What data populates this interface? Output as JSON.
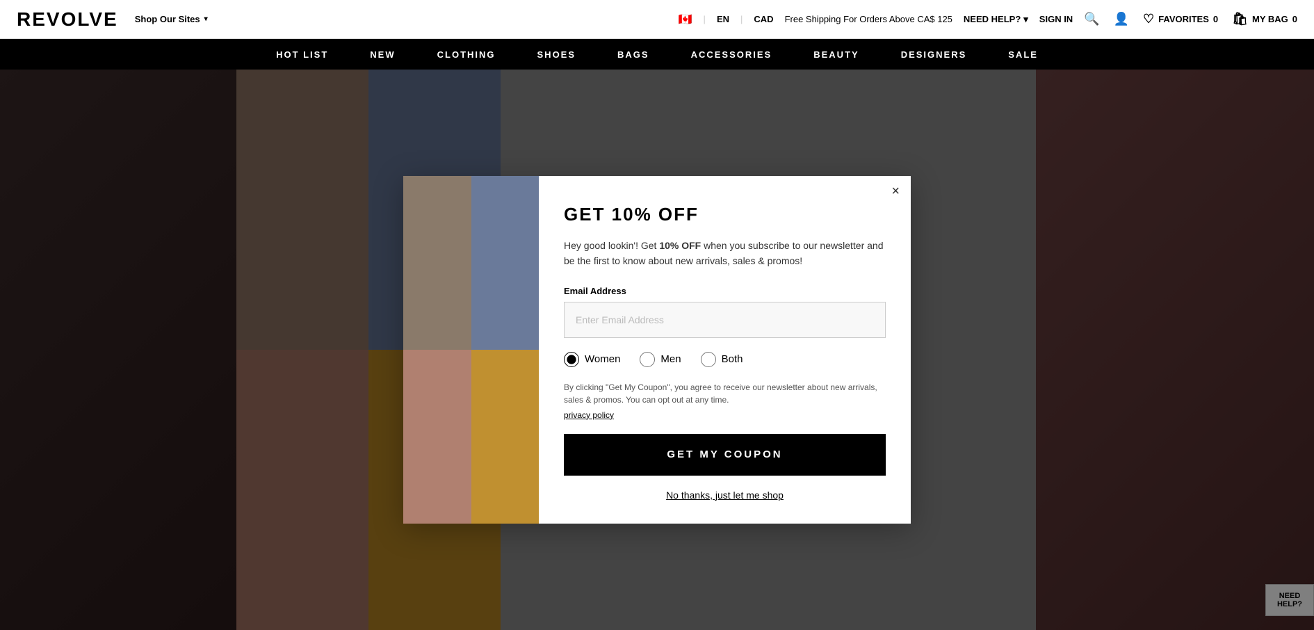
{
  "header": {
    "logo": "REVOLVE",
    "shop_sites_label": "Shop Our Sites",
    "flag_emoji": "🇨🇦",
    "language": "EN",
    "currency": "CAD",
    "shipping_text": "Free Shipping For Orders Above CA$ 125",
    "need_help_label": "NEED HELP?",
    "sign_in_label": "SIGN IN",
    "favorites_label": "FAVORITES",
    "favorites_count": "0",
    "bag_label": "MY BAG",
    "bag_count": "0"
  },
  "nav": {
    "items": [
      {
        "label": "HOT LIST"
      },
      {
        "label": "NEW"
      },
      {
        "label": "CLOTHING"
      },
      {
        "label": "SHOES"
      },
      {
        "label": "BAGS"
      },
      {
        "label": "ACCESSORIES"
      },
      {
        "label": "BEAUTY"
      },
      {
        "label": "DESIGNERS"
      },
      {
        "label": "SALE"
      }
    ]
  },
  "modal": {
    "title": "GET 10% OFF",
    "description_prefix": "Hey good lookin'! Get ",
    "description_bold": "10% OFF",
    "description_suffix": " when you subscribe to our newsletter and be the first to know about new arrivals, sales & promos!",
    "email_label": "Email Address",
    "email_placeholder": "Enter Email Address",
    "radio_options": [
      {
        "value": "women",
        "label": "Women",
        "checked": true
      },
      {
        "value": "men",
        "label": "Men",
        "checked": false
      },
      {
        "value": "both",
        "label": "Both",
        "checked": false
      }
    ],
    "terms_text": "By clicking \"Get My Coupon\", you agree to receive our newsletter about new arrivals, sales & promos. You can opt out at any time.",
    "privacy_link_text": "privacy policy",
    "coupon_button_label": "GET MY COUPON",
    "no_thanks_label": "No thanks, just let me shop",
    "close_icon": "×"
  },
  "need_help_float": {
    "line1": "NEED",
    "line2": "HELP?"
  }
}
